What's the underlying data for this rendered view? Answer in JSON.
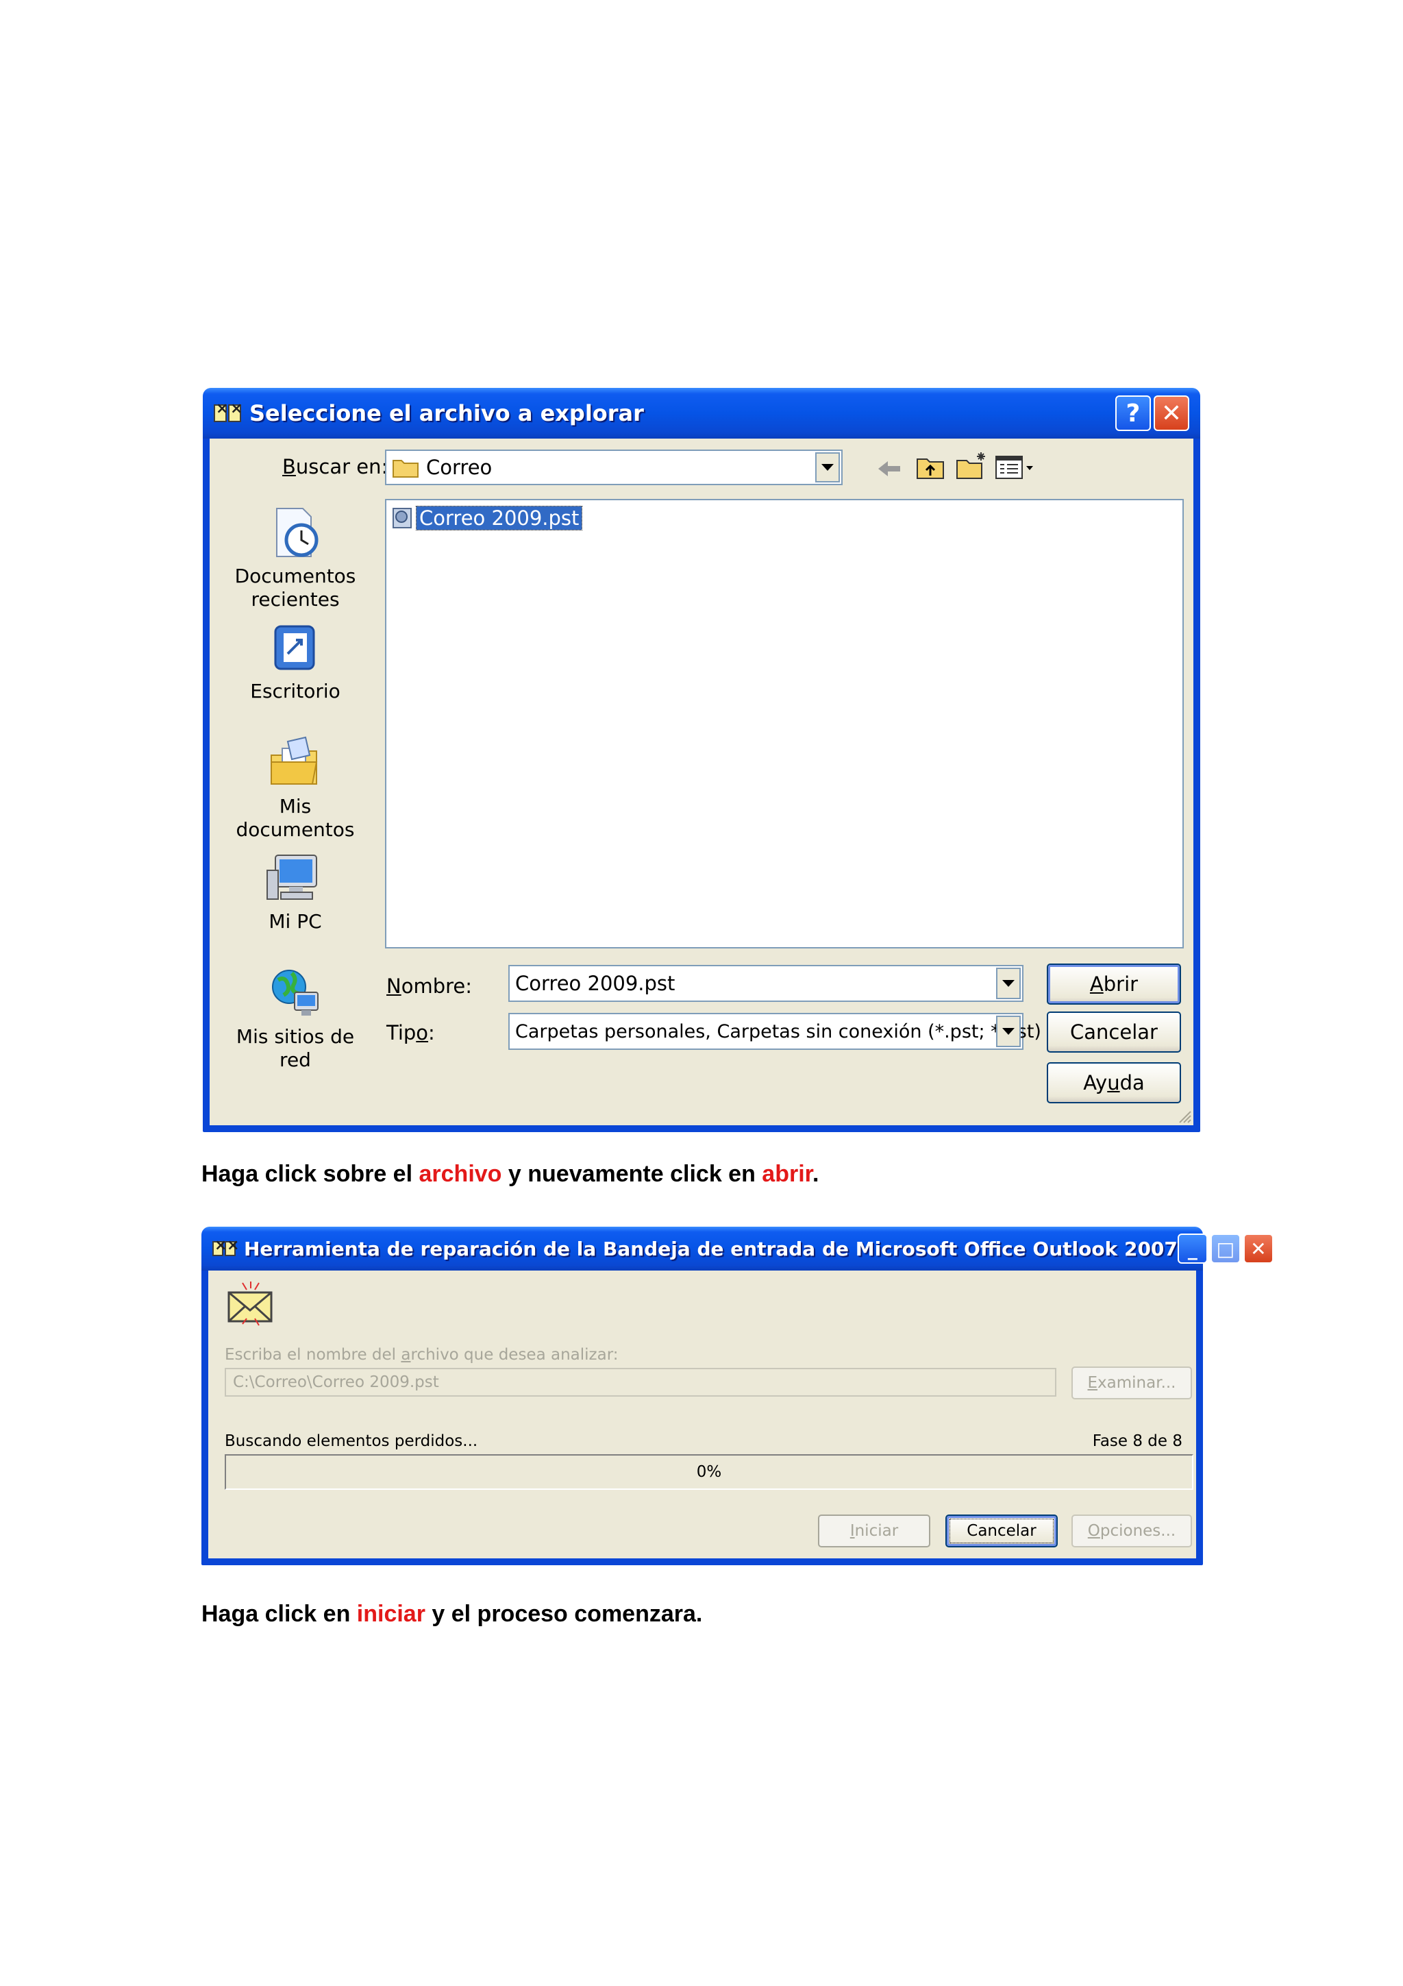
{
  "dialog1": {
    "title": "Seleccione el archivo a explorar",
    "help_button": "?",
    "close_button": "✕",
    "lookin_label_pre": "",
    "lookin_label_u": "B",
    "lookin_label_post": "uscar en:",
    "lookin_value": "Correo",
    "places": [
      {
        "line1": "Documentos",
        "line2": "recientes",
        "icon": "recent-documents-icon"
      },
      {
        "line1": "Escritorio",
        "line2": "",
        "icon": "desktop-icon"
      },
      {
        "line1": "Mis documentos",
        "line2": "",
        "icon": "my-documents-icon"
      },
      {
        "line1": "Mi PC",
        "line2": "",
        "icon": "my-computer-icon"
      },
      {
        "line1": "Mis sitios de red",
        "line2": "",
        "icon": "network-places-icon"
      }
    ],
    "files": [
      {
        "name": "Correo 2009.pst",
        "selected": true,
        "icon": "pst-file-icon"
      }
    ],
    "filename_label_u": "N",
    "filename_label_post": "ombre:",
    "filename_value": "Correo 2009.pst",
    "type_label_pre": "Tip",
    "type_label_u": "o",
    "type_label_post": ":",
    "type_value": "Carpetas personales, Carpetas sin conexión (*.pst; *.ost)",
    "open_button_u": "A",
    "open_button_post": "brir",
    "cancel_button": "Cancelar",
    "help_btn_pre": "Ay",
    "help_btn_u": "u",
    "help_btn_post": "da"
  },
  "caption1": {
    "part1": "Haga click sobre el ",
    "highlight1": "archivo",
    "part2": " y nuevamente click en ",
    "highlight2": "abrir",
    "part3": "."
  },
  "dialog2": {
    "title": "Herramienta de reparación de la Bandeja de entrada de Microsoft Office Outlook 2007",
    "minimize_button": "_",
    "maximize_button": "□",
    "close_button": "✕",
    "prompt_pre": "Escriba el nombre del ",
    "prompt_u": "a",
    "prompt_post": "rchivo que desea analizar:",
    "path_value": "C:\\Correo\\Correo 2009.pst",
    "browse_u": "E",
    "browse_post": "xaminar...",
    "status_text": "Buscando elementos perdidos...",
    "phase_text": "Fase 8 de 8",
    "progress_label": "0%",
    "progress_fraction": 0,
    "start_u": "I",
    "start_post": "niciar",
    "cancel_button": "Cancelar",
    "options_u": "O",
    "options_post": "pciones..."
  },
  "caption2": {
    "part1": "Haga click en ",
    "highlight1": "iniciar",
    "part2": " y el proceso comenzara."
  },
  "colors": {
    "highlight": "#e31919",
    "title_blue": "#0654e6",
    "dialog_face": "#ece9d8",
    "selection": "#316ac5"
  }
}
